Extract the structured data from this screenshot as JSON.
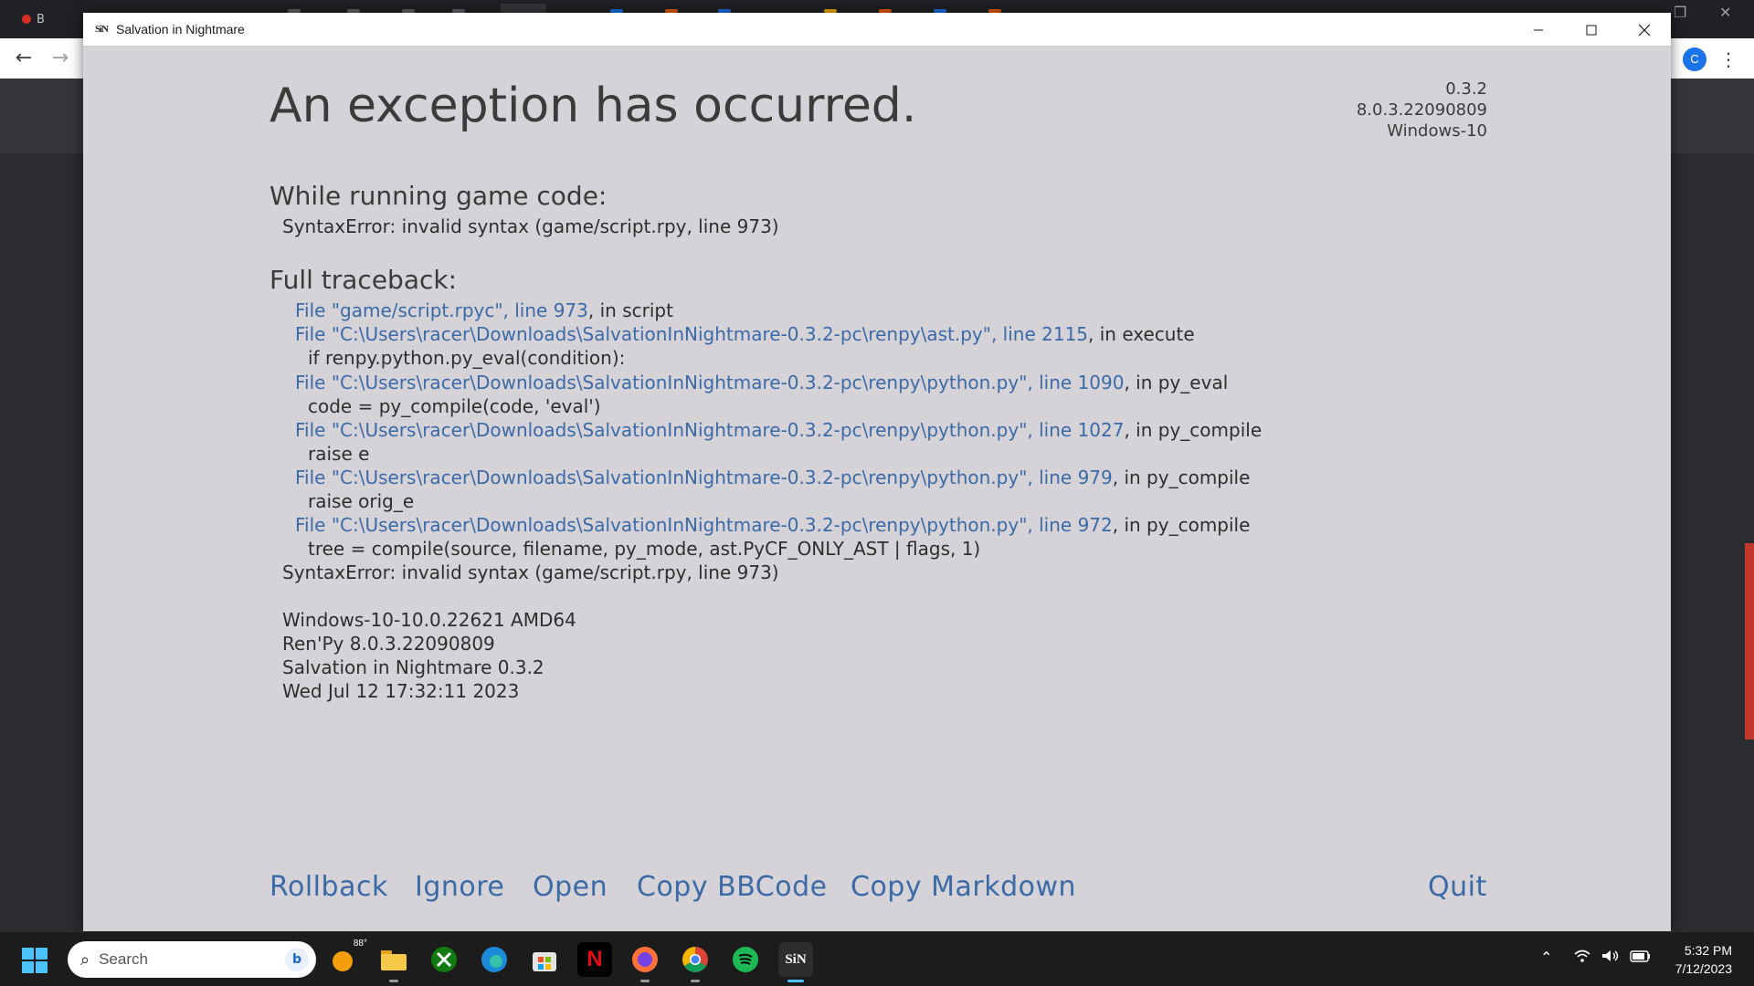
{
  "browser": {
    "tab_label_partial": "B",
    "profile_initial": "C"
  },
  "window": {
    "title": "Salvation in Nightmare",
    "icon_text": "SiN"
  },
  "error": {
    "heading": "An exception has occurred.",
    "versions": [
      "0.3.2",
      "8.0.3.22090809",
      "Windows-10"
    ],
    "while_running_heading": "While running game code:",
    "summary": "SyntaxError: invalid syntax (game/script.rpy, line 973)",
    "full_traceback_heading": "Full traceback:",
    "traceback": [
      {
        "link": "File \"game/script.rpyc\", line 973",
        "rest": ", in script",
        "code": ""
      },
      {
        "link": "File \"C:\\Users\\racer\\Downloads\\SalvationInNightmare-0.3.2-pc\\renpy\\ast.py\", line 2115",
        "rest": ", in execute",
        "code": "if renpy.python.py_eval(condition):"
      },
      {
        "link": "File \"C:\\Users\\racer\\Downloads\\SalvationInNightmare-0.3.2-pc\\renpy\\python.py\", line 1090",
        "rest": ", in py_eval",
        "code": "code = py_compile(code, 'eval')"
      },
      {
        "link": "File \"C:\\Users\\racer\\Downloads\\SalvationInNightmare-0.3.2-pc\\renpy\\python.py\", line 1027",
        "rest": ", in py_compile",
        "code": "raise e"
      },
      {
        "link": "File \"C:\\Users\\racer\\Downloads\\SalvationInNightmare-0.3.2-pc\\renpy\\python.py\", line 979",
        "rest": ", in py_compile",
        "code": "raise orig_e"
      },
      {
        "link": "File \"C:\\Users\\racer\\Downloads\\SalvationInNightmare-0.3.2-pc\\renpy\\python.py\", line 972",
        "rest": ", in py_compile",
        "code": "tree = compile(source, filename, py_mode, ast.PyCF_ONLY_AST | flags, 1)"
      }
    ],
    "final_error": "SyntaxError: invalid syntax (game/script.rpy, line 973)",
    "system_info": [
      "Windows-10-10.0.22621 AMD64",
      "Ren'Py 8.0.3.22090809",
      "Salvation in Nightmare 0.3.2",
      "Wed Jul 12 17:32:11 2023"
    ],
    "buttons": {
      "rollback": "Rollback",
      "ignore": "Ignore",
      "open": "Open",
      "copy_bbcode": "Copy BBCode",
      "copy_markdown": "Copy Markdown",
      "quit": "Quit"
    }
  },
  "taskbar": {
    "search_placeholder": "Search",
    "weather_temp": "88°",
    "apps": [
      "weather",
      "file-explorer",
      "xbox",
      "edge",
      "microsoft-store",
      "netflix",
      "firefox",
      "chrome",
      "spotify",
      "salvation-in-nightmare"
    ],
    "active_app_label": "SiN",
    "netflix_label": "N",
    "time": "5:32 PM",
    "date": "7/12/2023"
  }
}
